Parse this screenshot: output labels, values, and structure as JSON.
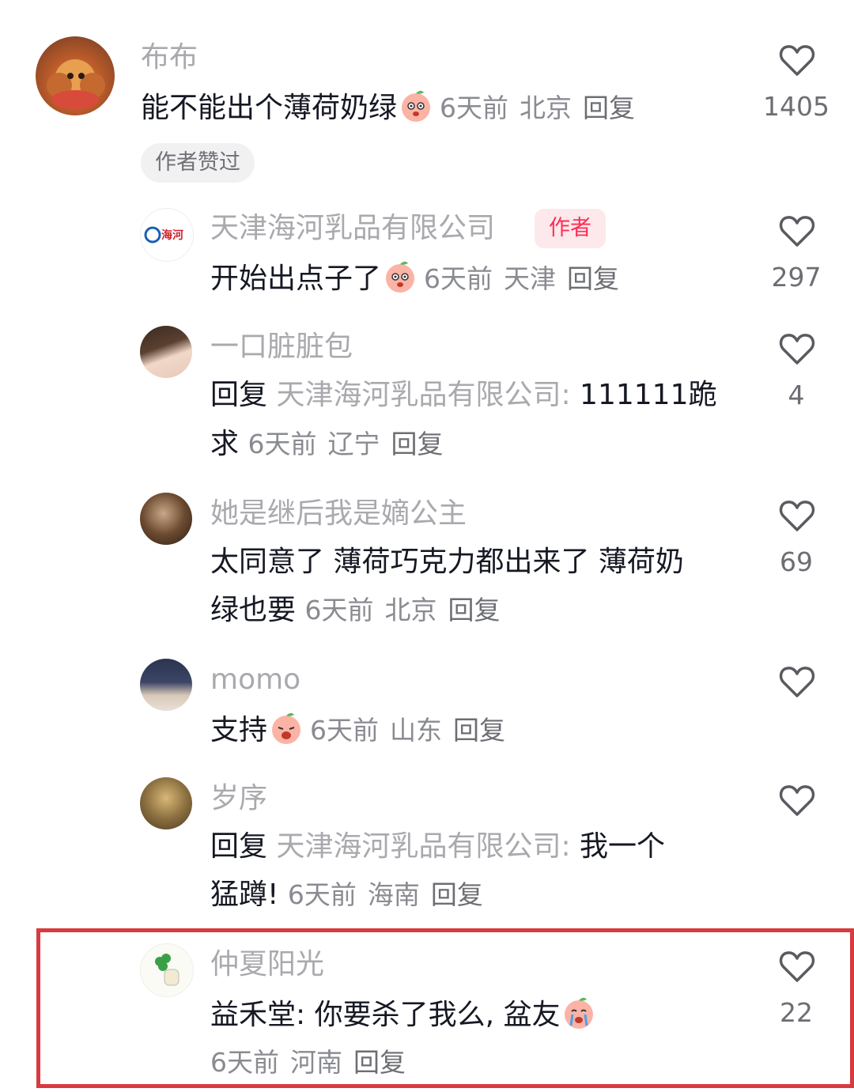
{
  "comments": [
    {
      "username": "布布",
      "text": "能不能出个薄荷奶绿",
      "time": "6天前",
      "location": "北京",
      "reply_label": "回复",
      "likes": "1405",
      "badge": "作者赞过",
      "emoji": "peach-face-emoji"
    },
    {
      "username": "天津海河乳品有限公司",
      "author_tag": "作者",
      "avatar_logo_text": "海河",
      "text": "开始出点子了",
      "time": "6天前",
      "location": "天津",
      "reply_label": "回复",
      "likes": "297",
      "emoji": "peach-face-emoji"
    },
    {
      "username": "一口脏脏包",
      "reply_prefix": "回复",
      "reply_target": "天津海河乳品有限公司:",
      "text_line1": " 111111跪",
      "text_line2": "求",
      "time": "6天前",
      "location": "辽宁",
      "reply_label": "回复",
      "likes": "4"
    },
    {
      "username": "她是继后我是嫡公主",
      "text_line1": "太同意了 薄荷巧克力都出来了 薄荷奶",
      "text_line2": "绿也要",
      "time": "6天前",
      "location": "北京",
      "reply_label": "回复",
      "likes": "69"
    },
    {
      "username": "momo",
      "text": "支持",
      "time": "6天前",
      "location": "山东",
      "reply_label": "回复",
      "likes": "",
      "emoji": "peach-face-emoji"
    },
    {
      "username": "岁序",
      "reply_prefix": "回复",
      "reply_target": "天津海河乳品有限公司:",
      "text_line1": " 我一个",
      "text_line2": "猛蹲!",
      "time": "6天前",
      "location": "海南",
      "reply_label": "回复",
      "likes": ""
    },
    {
      "username": "仲夏阳光",
      "text": "益禾堂: 你要杀了我么, 盆友",
      "time": "6天前",
      "location": "河南",
      "reply_label": "回复",
      "likes": "22",
      "emoji": "crying-peach-emoji"
    }
  ],
  "colors": {
    "username": "#a9a9ae",
    "text": "#161823",
    "meta": "#8a8b91",
    "author_tag": "#fe2c55",
    "highlight_border": "#d83a3f"
  }
}
